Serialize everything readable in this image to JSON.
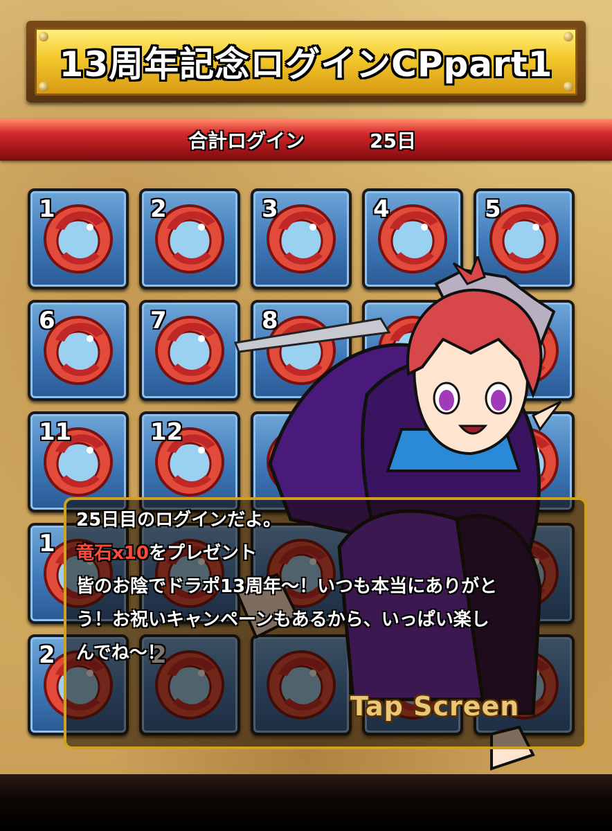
{
  "title": "13周年記念ログインCPpart1",
  "login_banner": {
    "label": "合計ログイン",
    "days": "25日"
  },
  "tiles": [
    {
      "number": "1"
    },
    {
      "number": "2"
    },
    {
      "number": "3"
    },
    {
      "number": "4"
    },
    {
      "number": "5"
    },
    {
      "number": "6"
    },
    {
      "number": "7"
    },
    {
      "number": "8"
    },
    {
      "number": ""
    },
    {
      "number": ""
    },
    {
      "number": "11"
    },
    {
      "number": "12"
    },
    {
      "number": ""
    },
    {
      "number": ""
    },
    {
      "number": ""
    },
    {
      "number": "1"
    },
    {
      "number": ""
    },
    {
      "number": ""
    },
    {
      "number": ""
    },
    {
      "number": ""
    },
    {
      "number": "2"
    },
    {
      "number": "2"
    },
    {
      "number": ""
    },
    {
      "number": ""
    },
    {
      "number": ""
    }
  ],
  "reward_icon": "dragon-stone-icon",
  "dialog": {
    "line1": "25日目のログインだよ。",
    "reward_highlight": "竜石x10",
    "reward_rest": "をプレゼント",
    "line3": "皆のお陰でドラポ13周年～！いつも本当にありがと",
    "line4": "う！お祝いキャンペーンもあるから、いっぱい楽し",
    "line5": "んでね～！"
  },
  "tap_label": "Tap Screen",
  "colors": {
    "tile_blue": "#3e78b8",
    "banner_red": "#d2282a",
    "title_gold": "#f2c82c",
    "highlight_red": "#ff4a3a"
  }
}
